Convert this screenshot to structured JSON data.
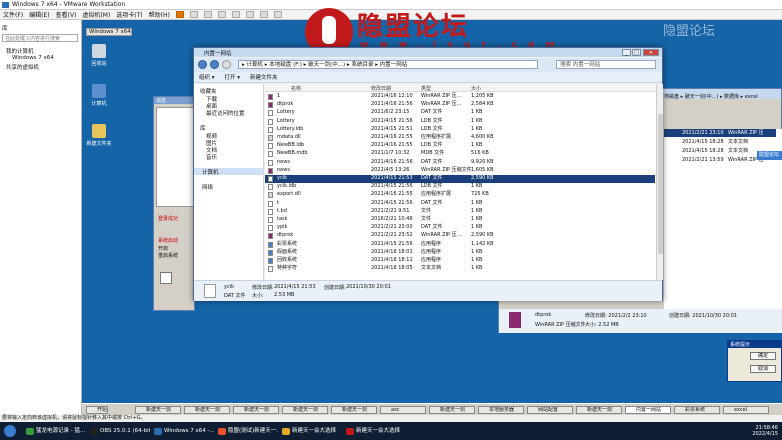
{
  "host": {
    "title": "Windows 7 x64 - VMware Workstation",
    "menu": [
      "文件(F)",
      "编辑(E)",
      "查看(V)",
      "虚拟机(M)",
      "选项卡(T)",
      "帮助(H)"
    ],
    "library": {
      "search_placeholder": "在此处键入内容进行搜索",
      "nodes": [
        "我的计算机",
        "Windows 7 x64",
        "共享的虚拟机"
      ]
    },
    "vm_tab": "Windows 7 x64",
    "status_hint": "要将输入定向到该虚拟机，请将鼠标指针移入其中或按 Ctrl+G。",
    "taskbar": [
      {
        "label": "猛龙电源记录 - 猛...",
        "color": "#3b9a3b"
      },
      {
        "label": "OBS 25.0.1 (64-bit...",
        "color": "#222222"
      },
      {
        "label": "Windows 7 x64 -...",
        "color": "#2a6db5"
      },
      {
        "label": "隐盟(测试)新建天一...",
        "color": "#e8532b"
      },
      {
        "label": "新建天一会大选择",
        "color": "#e8a82b"
      },
      {
        "label": "新建天一会大选择",
        "color": "#c21a1a"
      }
    ],
    "clock_time": "21:58:46",
    "clock_date": "2022/4/15"
  },
  "watermark": {
    "logo_text": "隐盟论坛",
    "logo_url": "w w w . i y u r . c o m",
    "corner": "隐盟论坛"
  },
  "desktop": {
    "icons": [
      "回收站",
      "计算机",
      "新建文件夹"
    ]
  },
  "explorer": {
    "title": "内置一网站",
    "address": "▸ 计算机 ▸ 本地磁盘 (F:) ▸ 破天一剑(中...) ▸ 系统目录 ▸ 内置一网站",
    "search_placeholder": "搜索 内置一网站",
    "commands": [
      "组织 ▾",
      "打开 ▾",
      "新建文件夹"
    ],
    "nav": {
      "favorites": "收藏夹",
      "fav_items": [
        "下载",
        "桌面",
        "最近访问的位置"
      ],
      "libraries": "库",
      "lib_items": [
        "视频",
        "图片",
        "文档",
        "音乐"
      ],
      "computer": "计算机",
      "network": "网络"
    },
    "columns": [
      "名称",
      "修改日期",
      "类型",
      "大小"
    ],
    "files": [
      {
        "name": "1",
        "date": "2021/4/16 12:10",
        "type": "WinRAR ZIP 压...",
        "size": "1,205 KB",
        "icon": "zip"
      },
      {
        "name": "dtprok",
        "date": "2021/4/16 21:56",
        "type": "WinRAR ZIP 压...",
        "size": "2,584 KB",
        "icon": "zip"
      },
      {
        "name": "Lottery",
        "date": "2021/6/2 23:15",
        "type": "DAT 文件",
        "size": "1 KB",
        "icon": "file"
      },
      {
        "name": "Lottery",
        "date": "2021/4/15 21:56",
        "type": "LDB 文件",
        "size": "1 KB",
        "icon": "file"
      },
      {
        "name": "Lottery.ldb",
        "date": "2021/4/15 21:51",
        "type": "LDB 文件",
        "size": "1 KB",
        "icon": "file"
      },
      {
        "name": "mdata.dll",
        "date": "2021/4/16 21:55",
        "type": "应用程序扩展",
        "size": "4,600 KB",
        "icon": "dll"
      },
      {
        "name": "NewBB.ldb",
        "date": "2021/4/16 21:55",
        "type": "LDB 文件",
        "size": "1 KB",
        "icon": "file"
      },
      {
        "name": "NewBB.mdb",
        "date": "2021/1/7 10:32",
        "type": "MDB 文件",
        "size": "516 KB",
        "icon": "file"
      },
      {
        "name": "news",
        "date": "2021/4/16 21:56",
        "type": "DAT 文件",
        "size": "9,920 KB",
        "icon": "file"
      },
      {
        "name": "news",
        "date": "2022/4/5 13:26",
        "type": "WinRAR ZIP 压缩文件",
        "size": "1,605 KB",
        "icon": "zip"
      },
      {
        "name": "ycik",
        "date": "2021/4/15 21:53",
        "type": "DAT 文件",
        "size": "2,590 KB",
        "icon": "file",
        "selected": true
      },
      {
        "name": "ycik.ldb",
        "date": "2021/4/15 21:56",
        "type": "LDB 文件",
        "size": "1 KB",
        "icon": "file"
      },
      {
        "name": "export.dll",
        "date": "2021/4/16 21:55",
        "type": "应用程序扩展",
        "size": "725 KB",
        "icon": "dll"
      },
      {
        "name": "t",
        "date": "2021/4/15 21:56",
        "type": "DAT 文件",
        "size": "1 KB",
        "icon": "file"
      },
      {
        "name": "t.bd",
        "date": "2021/2/21 9:51",
        "type": "文件",
        "size": "1 KB",
        "icon": "file"
      },
      {
        "name": "task",
        "date": "2016/2/21 10:46",
        "type": "文件",
        "size": "1 KB",
        "icon": "file"
      },
      {
        "name": "ypik",
        "date": "2021/2/21 23:00",
        "type": "DAT 文件",
        "size": "1 KB",
        "icon": "file"
      },
      {
        "name": "dtprok",
        "date": "2021/2/21 23:52",
        "type": "WinRAR ZIP 压...",
        "size": "2,590 KB",
        "icon": "zip"
      },
      {
        "name": "彩票系统",
        "date": "2021/4/15 21:56",
        "type": "应用程序",
        "size": "1,142 KB",
        "icon": "exe"
      },
      {
        "name": "假面系统",
        "date": "2021/4/16 18:01",
        "type": "应用程序",
        "size": "1 KB",
        "icon": "exe"
      },
      {
        "name": "回收系统",
        "date": "2021/4/16 18:11",
        "type": "应用程序",
        "size": "1 KB",
        "icon": "exe"
      },
      {
        "name": "特种字符",
        "date": "2021/4/16 18:05",
        "type": "文本文档",
        "size": "1 KB",
        "icon": "txt"
      }
    ],
    "details": {
      "name": "ycik",
      "type": "DAT 文件",
      "modified_label": "修改日期:",
      "modified": "2021/4/15 21:53",
      "created_label": "创建日期:",
      "created": "2021/10/30 20:01",
      "size_label": "大小:",
      "size": "2.53 MB"
    }
  },
  "right_pane": {
    "address": "本地磁盘 ▸ 破天一剑(中...) ▸ 数据库 ▸ excel",
    "rows": [
      {
        "date": "2021/2/21 23:10",
        "type": "WinRAR ZIP 压"
      },
      {
        "date": "2021/4/15 18:28",
        "type": "文本文档"
      },
      {
        "date": "2021/4/15 18:28",
        "type": "文本文档"
      },
      {
        "date": "2021/2/21 13:59",
        "type": "WinRAR ZIP 压"
      }
    ],
    "side_label": "隐盟论坛",
    "details_name": "dtprok",
    "details_type": "WinRAR ZIP 压缩文件",
    "details_mod": "修改日期: 2021/2/2 23:10",
    "details_created": "创建日期: 2021/10/30 20:01",
    "details_size": "大小: 2.52 MB"
  },
  "guest_taskbar": [
    "开始",
    "新建天一剑",
    "新建天一剑",
    "新建天一剑",
    "新建天一剑",
    "新建天一剑",
    "asc",
    "新建天一剑",
    "本地服务器",
    "网站配置",
    "新建天一剑",
    "内置一网站",
    "彩票系统",
    "excel"
  ],
  "dialog": {
    "title": "系统提示",
    "ok": "确定",
    "cancel": "取消"
  },
  "left_window": {
    "title": "消息",
    "labels": [
      "登录成功",
      "登录成功",
      "系统启动",
      "开启",
      "重启系统"
    ]
  }
}
